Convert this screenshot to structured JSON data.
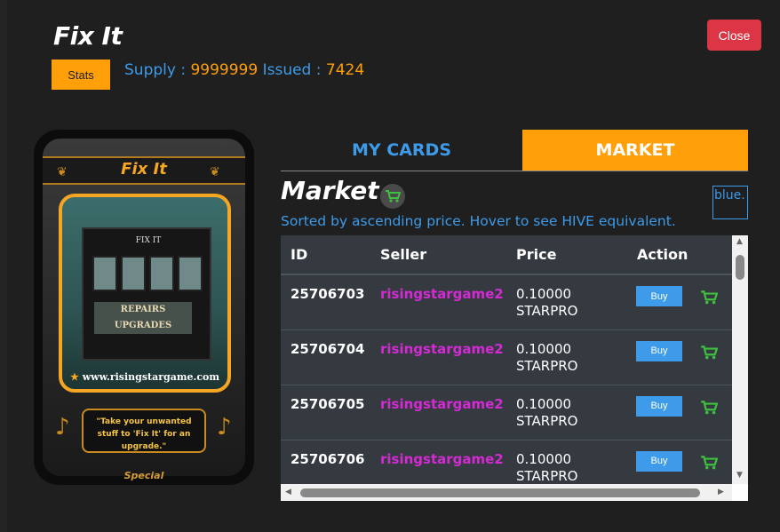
{
  "header": {
    "title": "Fix It",
    "close_label": "Close",
    "stats_label": "Stats",
    "supply_label": "Supply : ",
    "supply_value": "9999999",
    "issued_label": " Issued : ",
    "issued_value": "7424"
  },
  "card": {
    "name": "Fix It",
    "sign": "FIX IT",
    "shop_line1": "REPAIRS",
    "shop_line2": "UPGRADES",
    "url": "www.risingstargame.com",
    "quote": "\"Take your unwanted stuff to 'Fix It' for an upgrade.\"",
    "rarity": "Special"
  },
  "tabs": [
    {
      "label": "MY CARDS",
      "active": false
    },
    {
      "label": "MARKET",
      "active": true
    }
  ],
  "market": {
    "title": "Market",
    "sorted_text": "Sorted by ascending price. Hover to see HIVE equivalent.",
    "broken_image_alt": "blue.",
    "columns": [
      "ID",
      "Seller",
      "Price",
      "Action"
    ],
    "buy_label": "Buy",
    "rows": [
      {
        "id": "25706703",
        "seller": "risingstargame2",
        "price": "0.10000",
        "currency": "STARPRO"
      },
      {
        "id": "25706704",
        "seller": "risingstargame2",
        "price": "0.10000",
        "currency": "STARPRO"
      },
      {
        "id": "25706705",
        "seller": "risingstargame2",
        "price": "0.10000",
        "currency": "STARPRO"
      },
      {
        "id": "25706706",
        "seller": "risingstargame2",
        "price": "0.10000",
        "currency": "STARPRO"
      }
    ]
  },
  "colors": {
    "accent_orange": "#ff9f0a",
    "link_blue": "#3d9be9",
    "seller_magenta": "#d42ad4",
    "close_red": "#dc3545",
    "cart_green": "#3fbf3f"
  }
}
